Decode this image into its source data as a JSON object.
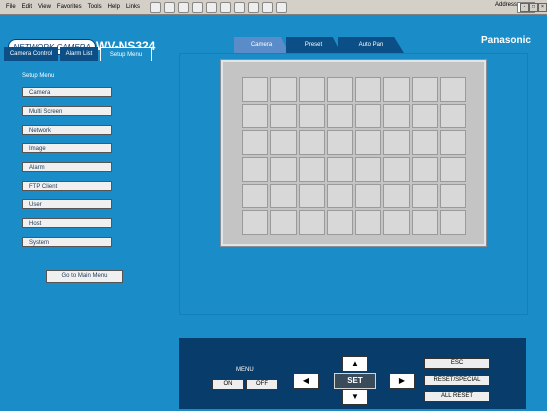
{
  "ie": {
    "menu": [
      "File",
      "Edit",
      "View",
      "Favorites",
      "Tools",
      "Help",
      "Links"
    ],
    "address_label": "Address",
    "window_controls": [
      "-",
      "□",
      "×"
    ]
  },
  "header": {
    "logo_text": "NETWORK CAMERA",
    "model": "WV-NS324",
    "brand": "Panasonic"
  },
  "tabs": {
    "camera_control": "Camera Control",
    "alarm_list": "Alarm List",
    "setup_menu": "Setup Menu"
  },
  "sidebar": {
    "heading": "Setup Menu",
    "items": [
      "Camera",
      "Multi Screen",
      "Network",
      "Image",
      "Alarm",
      "FTP Client",
      "User",
      "Host",
      "System"
    ],
    "main_menu_button": "Go to Main Menu"
  },
  "view_tabs": [
    "Camera",
    "Preset",
    "Auto Pan"
  ],
  "control": {
    "menu_label": "MENU",
    "on": "ON",
    "off": "OFF",
    "up": "▲",
    "down": "▼",
    "left": "◀",
    "right": "▶",
    "set": "SET",
    "esc": "ESC",
    "reset_special": "RESET/SPECIAL",
    "all_reset": "ALL RESET"
  }
}
